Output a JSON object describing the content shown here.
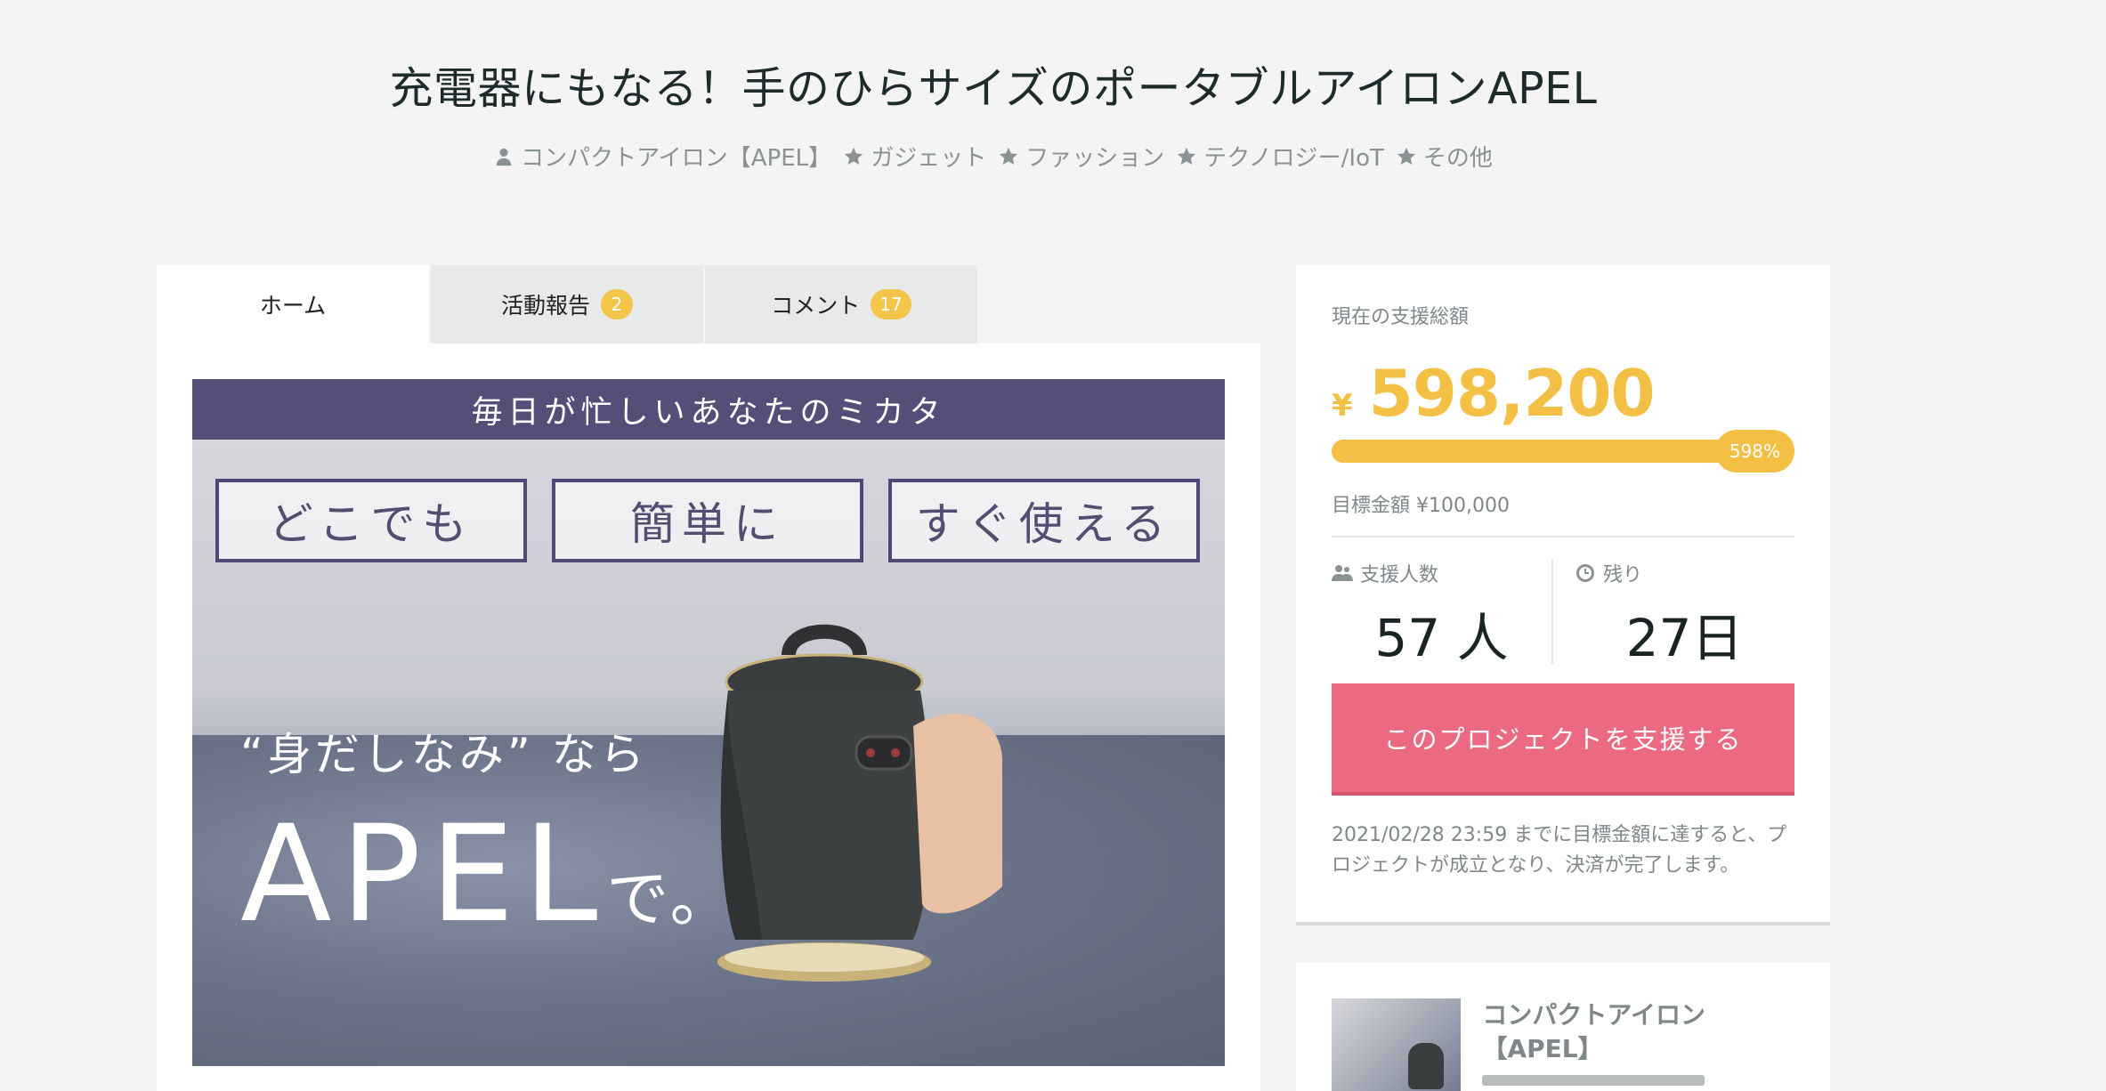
{
  "project": {
    "title": "充電器にもなる！手のひらサイズのポータブルアイロンAPEL",
    "owner": "コンパクトアイロン【APEL】",
    "categories": [
      "ガジェット",
      "ファッション",
      "テクノロジー/IoT",
      "その他"
    ]
  },
  "tabs": [
    {
      "label": "ホーム",
      "count": null,
      "active": true
    },
    {
      "label": "活動報告",
      "count": "2",
      "active": false
    },
    {
      "label": "コメント",
      "count": "17",
      "active": false
    }
  ],
  "hero": {
    "banner": "毎日が忙しいあなたのミカタ",
    "boxes": [
      "どこでも",
      "簡単に",
      "すぐ使える"
    ],
    "subtitle": "“身だしなみ” なら",
    "brand": "APEL",
    "brand_suffix": "で。"
  },
  "funding": {
    "current_label": "現在の支援総額",
    "currency": "¥",
    "amount": "598,200",
    "percent_text": "598%",
    "progress_fraction": 1.0,
    "goal_text": "目標金額 ¥100,000",
    "backers_label": "支援人数",
    "backers_value": "57 人",
    "remaining_label": "残り",
    "remaining_value": "27日",
    "cta": "このプロジェクトを支援する",
    "note": "2021/02/28 23:59 までに目標金額に達すると、プロジェクトが成立となり、決済が完了します。"
  },
  "owner_card": {
    "name": "コンパクトアイロン【APEL】"
  },
  "colors": {
    "accent": "#f3bf44",
    "cta": "#ec6982",
    "banner": "#564e78",
    "background": "#f3f4f3"
  },
  "icons": [
    "user-icon",
    "star-icon",
    "users-icon",
    "clock-icon"
  ]
}
